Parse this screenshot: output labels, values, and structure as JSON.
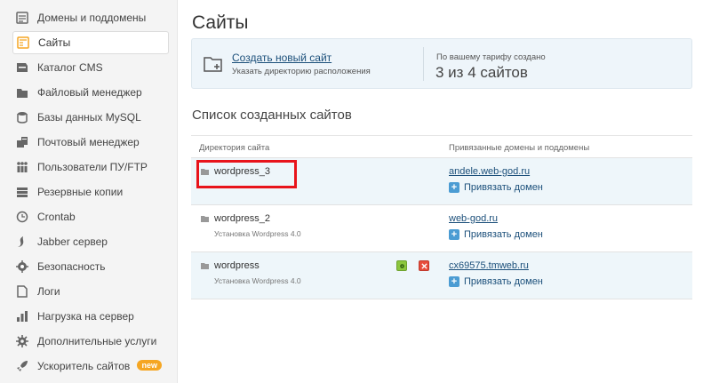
{
  "sidebar": {
    "items": [
      {
        "label": "Домены и поддомены",
        "icon": "domains-icon"
      },
      {
        "label": "Сайты",
        "icon": "sites-icon",
        "active": true
      },
      {
        "label": "Каталог CMS",
        "icon": "cms-catalog-icon"
      },
      {
        "label": "Файловый менеджер",
        "icon": "file-manager-icon"
      },
      {
        "label": "Базы данных MySQL",
        "icon": "database-icon"
      },
      {
        "label": "Почтовый менеджер",
        "icon": "mail-icon"
      },
      {
        "label": "Пользователи ПУ/FTP",
        "icon": "users-icon"
      },
      {
        "label": "Резервные копии",
        "icon": "backup-icon"
      },
      {
        "label": "Crontab",
        "icon": "clock-icon"
      },
      {
        "label": "Jabber сервер",
        "icon": "jabber-icon"
      },
      {
        "label": "Безопасность",
        "icon": "shield-icon"
      },
      {
        "label": "Логи",
        "icon": "logs-icon"
      },
      {
        "label": "Нагрузка на сервер",
        "icon": "bar-chart-icon"
      },
      {
        "label": "Дополнительные услуги",
        "icon": "gear-icon"
      },
      {
        "label": "Ускоритель сайтов",
        "icon": "rocket-icon",
        "badge": "new"
      }
    ]
  },
  "main": {
    "title": "Сайты",
    "create": {
      "link": "Создать новый сайт",
      "subtitle": "Указать директорию расположения",
      "quota_label": "По вашему тарифу создано",
      "quota_value": "3 из 4 сайтов"
    },
    "list_title": "Список созданных сайтов",
    "table": {
      "headers": [
        "Директория сайта",
        "Привязанные домены и поддомены"
      ],
      "bind_label": "Привязать домен",
      "rows": [
        {
          "name": "wordpress_3",
          "subtitle": "",
          "domain": "andele.web-god.ru"
        },
        {
          "name": "wordpress_2",
          "subtitle": "Установка Wordpress 4.0",
          "domain": "web-god.ru"
        },
        {
          "name": "wordpress",
          "subtitle": "Установка Wordpress 4.0",
          "domain": "cx69575.tmweb.ru"
        }
      ]
    }
  },
  "colors": {
    "accent": "#1b4f7a",
    "highlight": "#e8141b",
    "row_highlight": "#eef6fa",
    "badge": "#f5a623"
  }
}
